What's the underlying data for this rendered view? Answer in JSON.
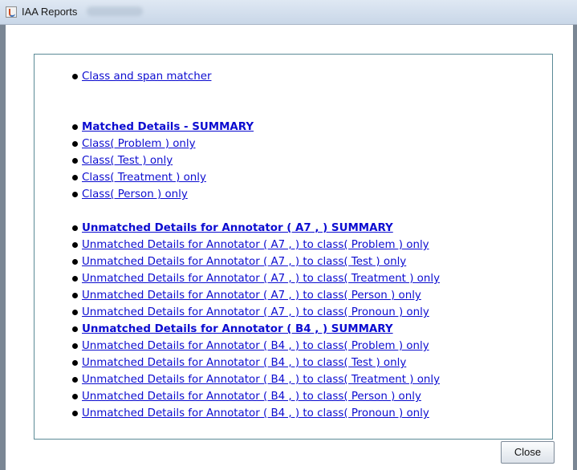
{
  "window": {
    "title": "IAA Reports",
    "close_label": "Close"
  },
  "reports": {
    "overview": [
      {
        "label": "Class and span matcher",
        "bold": false
      }
    ],
    "matched": [
      {
        "label": "Matched Details - SUMMARY ",
        "bold": true
      },
      {
        "label": "Class( Problem ) only",
        "bold": false
      },
      {
        "label": "Class( Test ) only",
        "bold": false
      },
      {
        "label": "Class( Treatment ) only",
        "bold": false
      },
      {
        "label": "Class( Person ) only",
        "bold": false
      }
    ],
    "unmatched": [
      {
        "label": "Unmatched Details for Annotator ( A7 , ) SUMMARY",
        "bold": true
      },
      {
        "label": "Unmatched Details for Annotator ( A7 , ) to class( Problem ) only",
        "bold": false
      },
      {
        "label": "Unmatched Details for Annotator ( A7 , ) to class( Test ) only",
        "bold": false
      },
      {
        "label": "Unmatched Details for Annotator ( A7 , ) to class( Treatment ) only",
        "bold": false
      },
      {
        "label": "Unmatched Details for Annotator ( A7 , ) to class( Person ) only",
        "bold": false
      },
      {
        "label": "Unmatched Details for Annotator ( A7 , ) to class( Pronoun ) only",
        "bold": false
      },
      {
        "label": "Unmatched Details for Annotator ( B4 , ) SUMMARY",
        "bold": true
      },
      {
        "label": "Unmatched Details for Annotator ( B4 , ) to class( Problem ) only",
        "bold": false
      },
      {
        "label": "Unmatched Details for Annotator ( B4 , ) to class( Test ) only",
        "bold": false
      },
      {
        "label": "Unmatched Details for Annotator ( B4 , ) to class( Treatment ) only",
        "bold": false
      },
      {
        "label": "Unmatched Details for Annotator ( B4 , ) to class( Person ) only",
        "bold": false
      },
      {
        "label": "Unmatched Details for Annotator ( B4 , ) to class( Pronoun ) only",
        "bold": false
      }
    ]
  },
  "colors": {
    "link": "#0c0cd0",
    "panel_border": "#5b8a96",
    "titlebar": "#d6e1ee"
  }
}
